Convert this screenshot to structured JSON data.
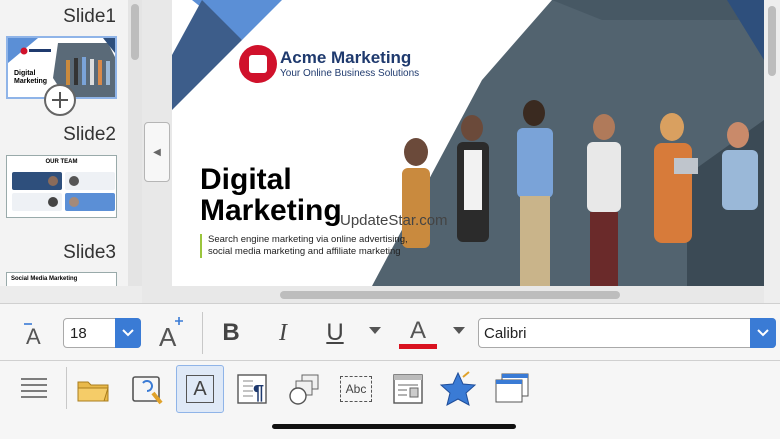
{
  "slide_panel": {
    "slides": [
      {
        "label": "Slide1",
        "thumb_title": "Digital Marketing"
      },
      {
        "label": "Slide2",
        "thumb_title": "OUR TEAM"
      },
      {
        "label": "Slide3",
        "thumb_title": "Social Media Marketing"
      }
    ],
    "add_slide_icon": "plus-circle-icon"
  },
  "slide": {
    "brand_title": "Acme Marketing",
    "brand_subtitle": "Your Online Business Solutions",
    "headline_line1": "Digital",
    "headline_line2": "Marketing",
    "subtext_line1": "Search engine marketing via online advertising,",
    "subtext_line2": "social media marketing and affiliate marketing",
    "watermark": "UpdateStar.com",
    "colors": {
      "brand_navy": "#1f3a6e",
      "logo_red": "#d0112b",
      "accent_green": "#9ac53d",
      "panel_blue": "#5b8fd6"
    }
  },
  "toolbar_top": {
    "font_size": "18",
    "font_name": "Calibri",
    "icons": [
      "decrease-font-icon",
      "increase-font-icon",
      "bold-icon",
      "italic-icon",
      "underline-icon",
      "font-color-icon"
    ],
    "bold_label": "B",
    "italic_label": "I",
    "underline_label": "U",
    "font_color_label": "A",
    "font_color": "#d9121f",
    "accent": "#3a7bd5"
  },
  "toolbar_bottom": {
    "icons": [
      "menu-lines-icon",
      "open-folder-icon",
      "format-paintbrush-icon",
      "text-box-icon",
      "paragraph-icon",
      "shapes-icon",
      "spelling-icon",
      "page-layout-icon",
      "star-effects-icon",
      "slide-sorter-icon"
    ],
    "text_box_label": "A",
    "spelling_label": "Abc"
  }
}
